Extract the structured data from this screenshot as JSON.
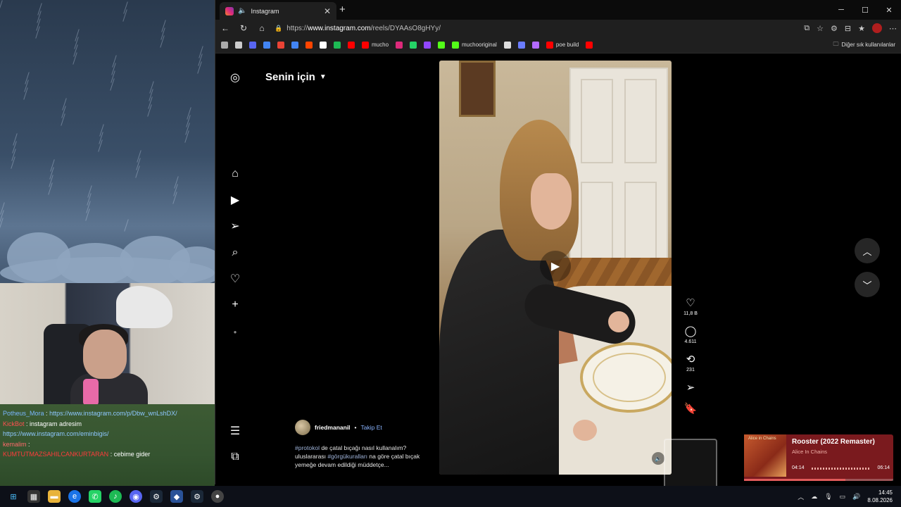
{
  "browser": {
    "tab_title": "Instagram",
    "url_scheme": "https://",
    "url_host": "www.instagram.com",
    "url_path": "/reels/DYAAsO8gHYy/",
    "bookmarks": [
      {
        "label": "",
        "color": "#aaaaaa"
      },
      {
        "label": "",
        "color": "#cccccc"
      },
      {
        "label": "",
        "color": "#5865f2"
      },
      {
        "label": "",
        "color": "#4285f4"
      },
      {
        "label": "",
        "color": "#ea4335"
      },
      {
        "label": "",
        "color": "#4285f4"
      },
      {
        "label": "",
        "color": "#ff4500"
      },
      {
        "label": "",
        "color": "#ffffff"
      },
      {
        "label": "",
        "color": "#1db954"
      },
      {
        "label": "",
        "color": "#ff0000"
      },
      {
        "label": "mucho",
        "color": "#ff0000"
      },
      {
        "label": "",
        "color": "#dd2a7b"
      },
      {
        "label": "",
        "color": "#25d366"
      },
      {
        "label": "",
        "color": "#9146ff"
      },
      {
        "label": "",
        "color": "#53fc18"
      },
      {
        "label": "muchooriginal",
        "color": "#53fc18"
      },
      {
        "label": "",
        "color": "#dddddd"
      },
      {
        "label": "",
        "color": "#6a7cff"
      },
      {
        "label": "",
        "color": "#b46aff"
      },
      {
        "label": "poe build",
        "color": "#ff0000"
      },
      {
        "label": "",
        "color": "#ff0000"
      }
    ],
    "other_bookmarks": "Diğer sık kullanılanlar"
  },
  "instagram": {
    "feed_title": "Senin için",
    "reel": {
      "username": "friedmananil",
      "follow_label": "Takip Et",
      "caption_parts": [
        "#protokol",
        " de çatal bıçağı nasıl kullanalım? uluslararası ",
        "#görgükuralları",
        " na göre çatal bıçak yemeğe devam edildiği müddetçe..."
      ],
      "likes": "11,8 B",
      "comments": "4.611",
      "reposts": "231"
    }
  },
  "chat": [
    {
      "user": "Potheus_Mora",
      "sep": " : ",
      "msg": "https://www.instagram.com/p/Dbw_wnLshDX/",
      "user_color": "#7ab6ff"
    },
    {
      "user": "KickBot",
      "sep": " : ",
      "msg": "instagram adresim",
      "user_color": "#ff5050"
    },
    {
      "user": "",
      "sep": "",
      "msg": "https://www.instagram.com/eminbigis/",
      "user_color": "#ffffff"
    },
    {
      "user": "kemalim",
      "sep": " : ",
      "msg": "",
      "user_color": "#ff6a6a"
    },
    {
      "user": "KUMTUTMAZSAHILCANKURTARAN",
      "sep": " : ",
      "msg": "cebime gider",
      "user_color": "#ff3b3b"
    }
  ],
  "spotify": {
    "track": "Rooster (2022 Remaster)",
    "artist": "Alice In Chains",
    "album_label": "Alice in Chains",
    "current": "04:14",
    "duration": "06:14",
    "progress": 0.68
  },
  "taskbar": {
    "time": "14:45",
    "date": "8.08.2026"
  }
}
